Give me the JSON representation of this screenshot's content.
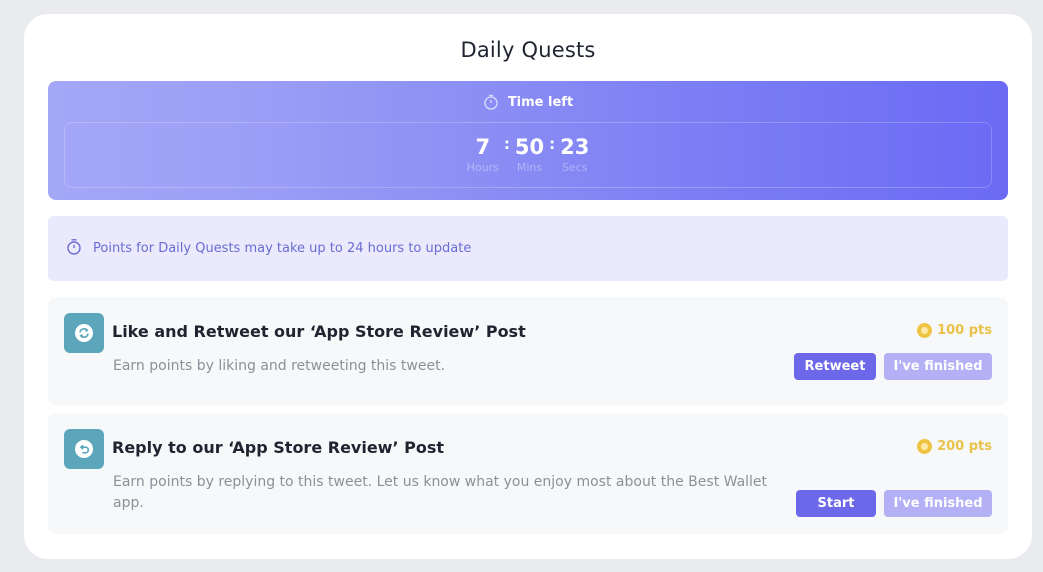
{
  "page": {
    "title": "Daily Quests"
  },
  "timer": {
    "label": "Time left",
    "hours": "7",
    "hours_label": "Hours",
    "mins": "50",
    "mins_label": "Mins",
    "secs": "23",
    "secs_label": "Secs",
    "separator": ":",
    "icon": "stopwatch-icon"
  },
  "notice": {
    "text": "Points for Daily Quests may take up to 24 hours to update",
    "icon": "stopwatch-icon"
  },
  "quests": [
    {
      "title": "Like and Retweet our ‘App Store Review’ Post",
      "description": "Earn points by liking and retweeting this tweet.",
      "points": "100 pts",
      "action_label": "Retweet",
      "finished_label": "I've finished",
      "icon": "retweet-icon"
    },
    {
      "title": "Reply to our ‘App Store Review’ Post",
      "description": "Earn points by replying to this tweet. Let us know what you enjoy most about the Best Wallet app.",
      "points": "200 pts",
      "action_label": "Start",
      "finished_label": "I've finished",
      "icon": "reply-icon"
    }
  ],
  "colors": {
    "accent": "#6d68e9",
    "accent_light": "#b3b0f5",
    "points_gold": "#e9c24a",
    "quest_icon_bg": "#5ba6ba",
    "notice_bg": "#ebeafc"
  }
}
